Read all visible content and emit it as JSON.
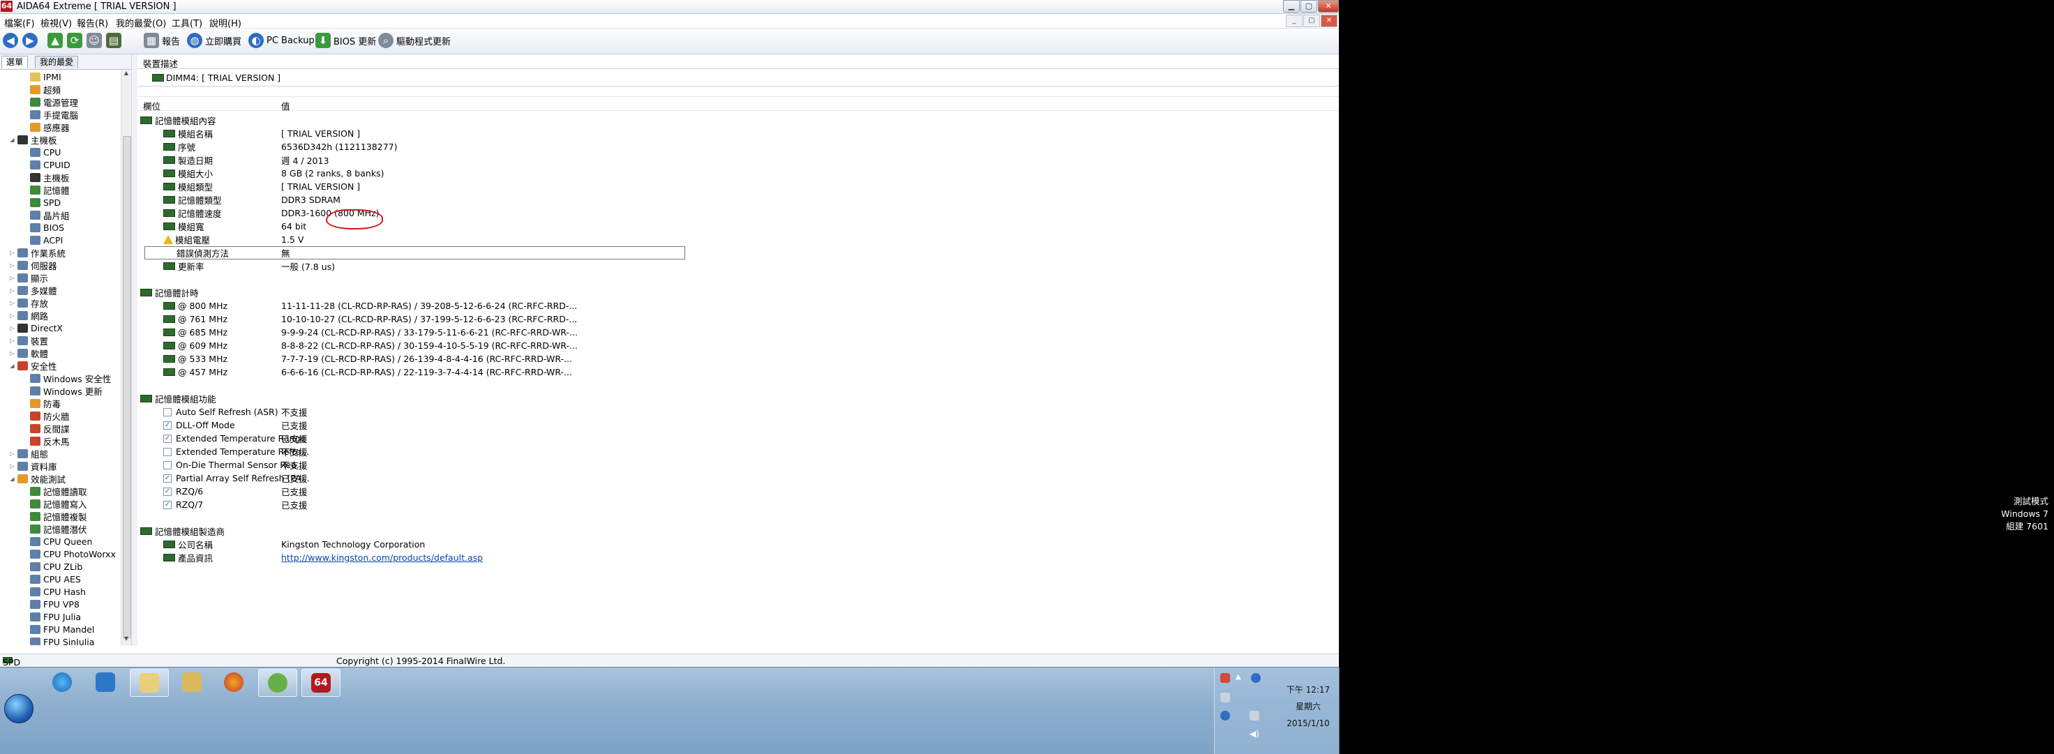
{
  "window": {
    "logo": "64",
    "title": "AIDA64 Extreme  [ TRIAL VERSION ]"
  },
  "menu": [
    "檔案(F)",
    "檢視(V)",
    "報告(R)",
    "我的最愛(O)",
    "工具(T)",
    "說明(H)"
  ],
  "toolbar": {
    "report": "報告",
    "buy": "立即購買",
    "backup": "PC Backup",
    "bios": "BIOS 更新",
    "driver": "驅動程式更新"
  },
  "left_tabs": {
    "menu": "選單",
    "favorites": "我的最愛"
  },
  "tree": [
    {
      "label": "IPMI",
      "indent": 2,
      "icon": "c",
      "toggle": ""
    },
    {
      "label": "超頻",
      "indent": 2,
      "icon": "o",
      "toggle": ""
    },
    {
      "label": "電源管理",
      "indent": 2,
      "icon": "g",
      "toggle": ""
    },
    {
      "label": "手提電腦",
      "indent": 2,
      "icon": "",
      "toggle": ""
    },
    {
      "label": "感應器",
      "indent": 2,
      "icon": "o",
      "toggle": ""
    },
    {
      "label": "主機板",
      "indent": 1,
      "icon": "k",
      "toggle": "◢"
    },
    {
      "label": "CPU",
      "indent": 2,
      "icon": "",
      "toggle": ""
    },
    {
      "label": "CPUID",
      "indent": 2,
      "icon": "",
      "toggle": ""
    },
    {
      "label": "主機板",
      "indent": 2,
      "icon": "k",
      "toggle": ""
    },
    {
      "label": "記憶體",
      "indent": 2,
      "icon": "g",
      "toggle": ""
    },
    {
      "label": "SPD",
      "indent": 2,
      "icon": "g",
      "toggle": ""
    },
    {
      "label": "晶片組",
      "indent": 2,
      "icon": "",
      "toggle": ""
    },
    {
      "label": "BIOS",
      "indent": 2,
      "icon": "",
      "toggle": ""
    },
    {
      "label": "ACPI",
      "indent": 2,
      "icon": "",
      "toggle": ""
    },
    {
      "label": "作業系統",
      "indent": 1,
      "icon": "",
      "toggle": "▷"
    },
    {
      "label": "伺服器",
      "indent": 1,
      "icon": "",
      "toggle": "▷"
    },
    {
      "label": "顯示",
      "indent": 1,
      "icon": "",
      "toggle": "▷"
    },
    {
      "label": "多媒體",
      "indent": 1,
      "icon": "",
      "toggle": "▷"
    },
    {
      "label": "存放",
      "indent": 1,
      "icon": "",
      "toggle": "▷"
    },
    {
      "label": "網路",
      "indent": 1,
      "icon": "",
      "toggle": "▷"
    },
    {
      "label": "DirectX",
      "indent": 1,
      "icon": "k",
      "toggle": "▷"
    },
    {
      "label": "裝置",
      "indent": 1,
      "icon": "",
      "toggle": "▷"
    },
    {
      "label": "軟體",
      "indent": 1,
      "icon": "",
      "toggle": "▷"
    },
    {
      "label": "安全性",
      "indent": 1,
      "icon": "r",
      "toggle": "◢"
    },
    {
      "label": "Windows 安全性",
      "indent": 2,
      "icon": "",
      "toggle": ""
    },
    {
      "label": "Windows 更新",
      "indent": 2,
      "icon": "",
      "toggle": ""
    },
    {
      "label": "防毒",
      "indent": 2,
      "icon": "o",
      "toggle": ""
    },
    {
      "label": "防火牆",
      "indent": 2,
      "icon": "r",
      "toggle": ""
    },
    {
      "label": "反間諜",
      "indent": 2,
      "icon": "r",
      "toggle": ""
    },
    {
      "label": "反木馬",
      "indent": 2,
      "icon": "r",
      "toggle": ""
    },
    {
      "label": "組態",
      "indent": 1,
      "icon": "",
      "toggle": "▷"
    },
    {
      "label": "資料庫",
      "indent": 1,
      "icon": "",
      "toggle": "▷"
    },
    {
      "label": "效能測試",
      "indent": 1,
      "icon": "o",
      "toggle": "◢"
    },
    {
      "label": "記憶體讀取",
      "indent": 2,
      "icon": "g",
      "toggle": ""
    },
    {
      "label": "記憶體寫入",
      "indent": 2,
      "icon": "g",
      "toggle": ""
    },
    {
      "label": "記憶體複製",
      "indent": 2,
      "icon": "g",
      "toggle": ""
    },
    {
      "label": "記憶體潛伏",
      "indent": 2,
      "icon": "g",
      "toggle": ""
    },
    {
      "label": "CPU Queen",
      "indent": 2,
      "icon": "",
      "toggle": ""
    },
    {
      "label": "CPU PhotoWorxx",
      "indent": 2,
      "icon": "",
      "toggle": ""
    },
    {
      "label": "CPU ZLib",
      "indent": 2,
      "icon": "",
      "toggle": ""
    },
    {
      "label": "CPU AES",
      "indent": 2,
      "icon": "",
      "toggle": ""
    },
    {
      "label": "CPU Hash",
      "indent": 2,
      "icon": "",
      "toggle": ""
    },
    {
      "label": "FPU VP8",
      "indent": 2,
      "icon": "",
      "toggle": ""
    },
    {
      "label": "FPU Julia",
      "indent": 2,
      "icon": "",
      "toggle": ""
    },
    {
      "label": "FPU Mandel",
      "indent": 2,
      "icon": "",
      "toggle": ""
    },
    {
      "label": "FPU SinJulia",
      "indent": 2,
      "icon": "",
      "toggle": ""
    }
  ],
  "panel": {
    "header": "裝置描述",
    "device": "DIMM4: [ TRIAL VERSION ]",
    "col_field": "欄位",
    "col_value": "值"
  },
  "sections": [
    {
      "title": "記憶體模組內容",
      "rows": [
        {
          "field": "模組名稱",
          "value": "[ TRIAL VERSION ]",
          "icon": "mem"
        },
        {
          "field": "序號",
          "value": "6536D342h (1121138277)",
          "icon": "mem"
        },
        {
          "field": "製造日期",
          "value": "週 4 / 2013",
          "icon": "mem"
        },
        {
          "field": "模組大小",
          "value": "8 GB (2 ranks, 8 banks)",
          "icon": "mem"
        },
        {
          "field": "模組類型",
          "value": "[ TRIAL VERSION ]",
          "icon": "mem"
        },
        {
          "field": "記憶體類型",
          "value": "DDR3 SDRAM",
          "icon": "mem"
        },
        {
          "field": "記憶體速度",
          "value": "DDR3-1600 (800 MHz)",
          "icon": "mem"
        },
        {
          "field": "模組寬",
          "value": "64 bit",
          "icon": "mem"
        },
        {
          "field": "模組電壓",
          "value": "1.5 V",
          "icon": "warn"
        },
        {
          "field": "錯誤偵測方法",
          "value": "無",
          "icon": "none"
        },
        {
          "field": "更新率",
          "value": "一般 (7.8 us)",
          "icon": "mem"
        }
      ]
    },
    {
      "title": "記憶體計時",
      "rows": [
        {
          "field": "@ 800 MHz",
          "value": "11-11-11-28  (CL-RCD-RP-RAS) / 39-208-5-12-6-6-24  (RC-RFC-RRD-...",
          "icon": "mem"
        },
        {
          "field": "@ 761 MHz",
          "value": "10-10-10-27  (CL-RCD-RP-RAS) / 37-199-5-12-6-6-23  (RC-RFC-RRD-...",
          "icon": "mem"
        },
        {
          "field": "@ 685 MHz",
          "value": "9-9-9-24  (CL-RCD-RP-RAS) / 33-179-5-11-6-6-21  (RC-RFC-RRD-WR-...",
          "icon": "mem"
        },
        {
          "field": "@ 609 MHz",
          "value": "8-8-8-22  (CL-RCD-RP-RAS) / 30-159-4-10-5-5-19  (RC-RFC-RRD-WR-...",
          "icon": "mem"
        },
        {
          "field": "@ 533 MHz",
          "value": "7-7-7-19  (CL-RCD-RP-RAS) / 26-139-4-8-4-4-16  (RC-RFC-RRD-WR-...",
          "icon": "mem"
        },
        {
          "field": "@ 457 MHz",
          "value": "6-6-6-16  (CL-RCD-RP-RAS) / 22-119-3-7-4-4-14  (RC-RFC-RRD-WR-...",
          "icon": "mem"
        }
      ]
    },
    {
      "title": "記憶體模組功能",
      "rows": [
        {
          "field": "Auto Self Refresh (ASR)",
          "value": "不支援",
          "icon": "chk",
          "checked": false
        },
        {
          "field": "DLL-Off Mode",
          "value": "已支援",
          "icon": "chk",
          "checked": true
        },
        {
          "field": "Extended Temperature Range",
          "value": "已支援",
          "icon": "chk",
          "checked": true
        },
        {
          "field": "Extended Temperature Refre...",
          "value": "不支援",
          "icon": "chk",
          "checked": false
        },
        {
          "field": "On-Die Thermal Sensor Rea...",
          "value": "不支援",
          "icon": "chk",
          "checked": false
        },
        {
          "field": "Partial Array Self Refresh (PA...",
          "value": "已支援",
          "icon": "chk",
          "checked": true
        },
        {
          "field": "RZQ/6",
          "value": "已支援",
          "icon": "chk",
          "checked": true
        },
        {
          "field": "RZQ/7",
          "value": "已支援",
          "icon": "chk",
          "checked": true
        }
      ]
    },
    {
      "title": "記憶體模組製造商",
      "rows": [
        {
          "field": "公司名稱",
          "value": "Kingston Technology Corporation",
          "icon": "mem"
        },
        {
          "field": "產品資訊",
          "value": "http://www.kingston.com/products/default.asp",
          "icon": "mem",
          "link": true
        }
      ]
    }
  ],
  "status": {
    "left": "SPD",
    "center": "Copyright (c) 1995-2014 FinalWire Ltd."
  },
  "tray": {
    "time": "下午 12:17",
    "day": "星期六",
    "date": "2015/1/10"
  },
  "watermark": [
    "測試模式",
    "Windows 7",
    "組建 7601"
  ]
}
